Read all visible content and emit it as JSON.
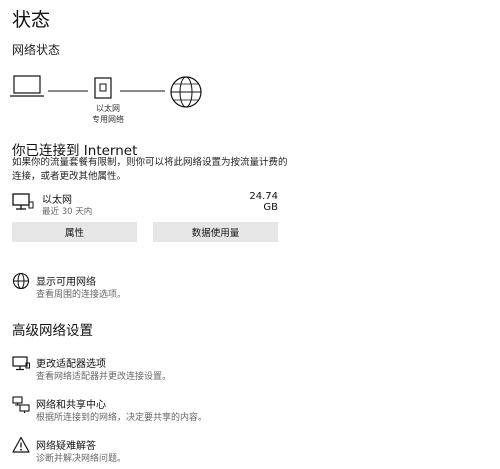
{
  "header": {
    "title": "状态"
  },
  "network_status": {
    "heading": "网络状态",
    "adapter_label_line1": "以太网",
    "adapter_label_line2": "专用网络"
  },
  "connection": {
    "heading": "你已连接到 Internet",
    "description_line1": "如果你的流量套餐有限制，则你可以将此网络设置为按流量计费的",
    "description_line2": "连接，或者更改其他属性。",
    "ethernet": {
      "name": "以太网",
      "period": "最近 30 天内",
      "data_used": "24.74 GB"
    },
    "buttons": {
      "properties": "属性",
      "data_usage": "数据使用量"
    }
  },
  "available_networks": {
    "title": "显示可用网络",
    "subtitle": "查看周围的连接选项。"
  },
  "advanced": {
    "heading": "高级网络设置",
    "items": [
      {
        "title": "更改适配器选项",
        "subtitle": "查看网络适配器并更改连接设置。",
        "icon": "adapter-icon"
      },
      {
        "title": "网络和共享中心",
        "subtitle": "根据所连接到的网络，决定要共享的内容。",
        "icon": "sharing-center-icon"
      },
      {
        "title": "网络疑难解答",
        "subtitle": "诊断并解决网络问题。",
        "icon": "warning-icon"
      }
    ]
  }
}
